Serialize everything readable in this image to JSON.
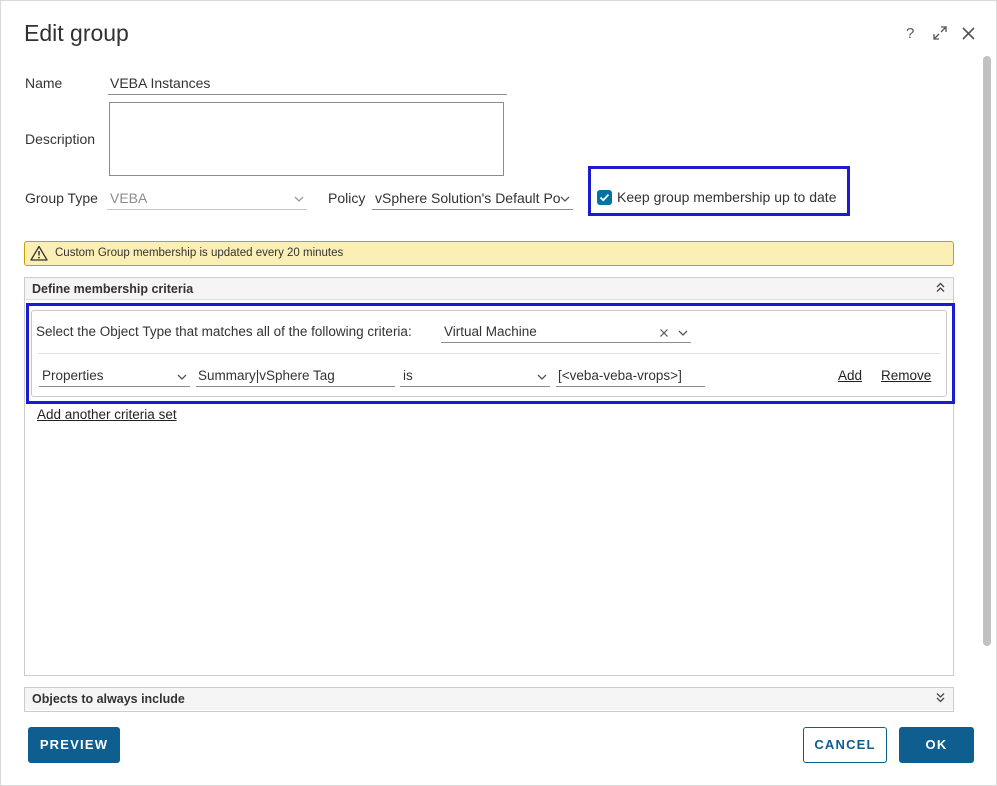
{
  "dialog": {
    "title": "Edit group",
    "help_label": "?",
    "icons": [
      "help-icon",
      "expand-icon",
      "close-icon"
    ]
  },
  "form": {
    "name_label": "Name",
    "name_value": "VEBA Instances",
    "description_label": "Description",
    "description_value": "",
    "group_type_label": "Group Type",
    "group_type_value": "VEBA",
    "policy_label": "Policy",
    "policy_value": "vSphere Solution's Default Po",
    "keep_membership_label": "Keep group membership up to date",
    "keep_membership_checked": true
  },
  "alert": {
    "text": "Custom Group membership is updated every 20 minutes"
  },
  "membership": {
    "header": "Define membership criteria",
    "object_type_prompt": "Select the Object Type that matches all of the following criteria:",
    "object_type_value": "Virtual Machine",
    "criteria": {
      "category": "Properties",
      "property": "Summary|vSphere Tag",
      "operator": "is",
      "value": "[<veba-veba-vrops>]",
      "add_label": "Add",
      "remove_label": "Remove"
    },
    "add_set_label": "Add another criteria set"
  },
  "include_section": {
    "header": "Objects to always include"
  },
  "footer": {
    "preview_label": "PREVIEW",
    "cancel_label": "CANCEL",
    "ok_label": "OK"
  },
  "colors": {
    "primary": "#0e5e8f",
    "highlight": "#1b1bd1",
    "alert_bg": "#fcefb6",
    "checkbox": "#0072a3"
  }
}
